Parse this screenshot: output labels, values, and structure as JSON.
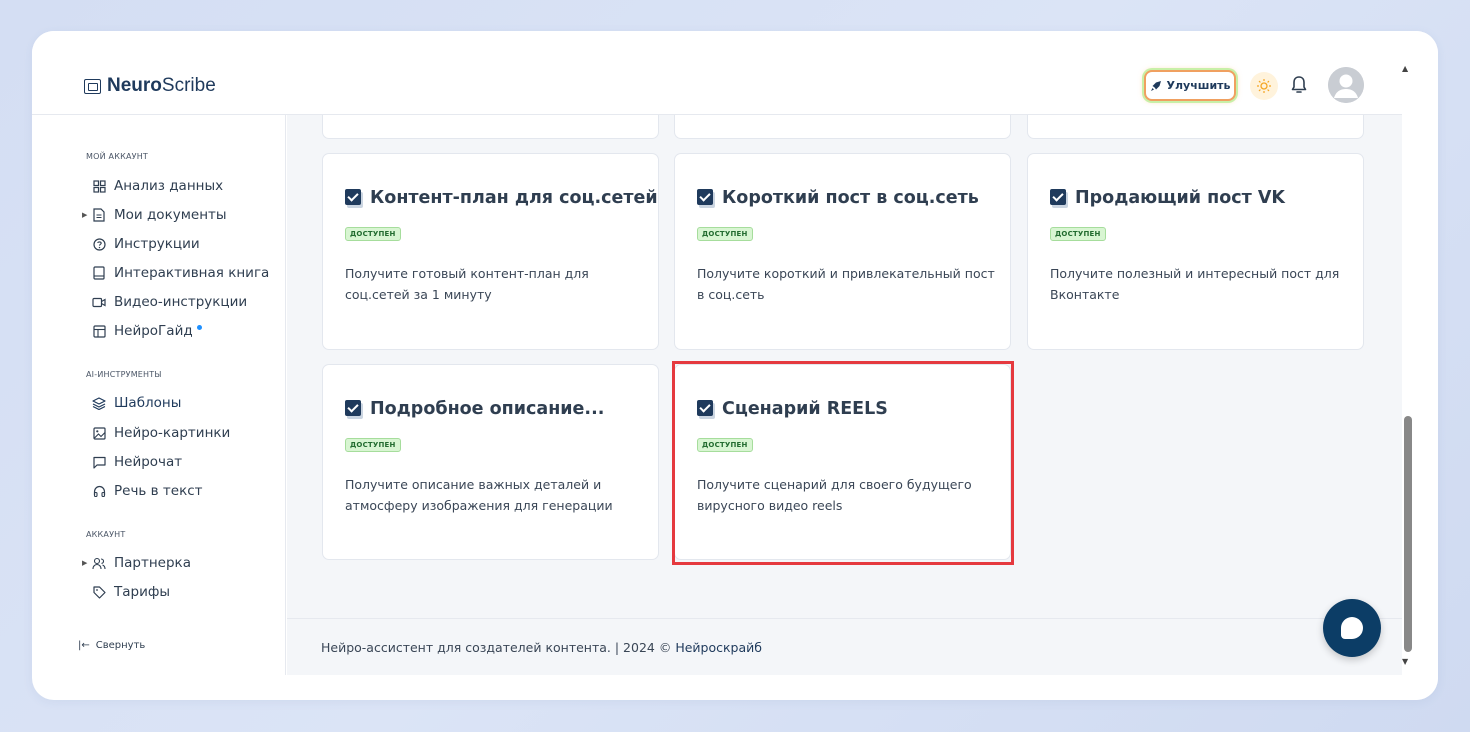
{
  "app": {
    "logo_bold": "Neuro",
    "logo_light": "Scribe"
  },
  "header": {
    "upgrade_label": "Улучшить"
  },
  "sidebar": {
    "sections": [
      {
        "title": "МОЙ АККАУНТ"
      },
      {
        "title": "AI-ИНСТРУМЕНТЫ"
      },
      {
        "title": "АККАУНТ"
      }
    ],
    "items": [
      {
        "label": "Анализ данных",
        "icon": "grid-icon"
      },
      {
        "label": "Мои документы",
        "icon": "document-icon"
      },
      {
        "label": "Инструкции",
        "icon": "help-circle-icon"
      },
      {
        "label": "Интерактивная книга",
        "icon": "book-icon"
      },
      {
        "label": "Видео-инструкции",
        "icon": "video-icon"
      },
      {
        "label": "НейроГайд",
        "icon": "layout-icon"
      },
      {
        "label": "Шаблоны",
        "icon": "layers-icon"
      },
      {
        "label": "Нейро-картинки",
        "icon": "image-icon"
      },
      {
        "label": "Нейрочат",
        "icon": "message-icon"
      },
      {
        "label": "Речь в текст",
        "icon": "headphones-icon"
      },
      {
        "label": "Партнерка",
        "icon": "users-icon"
      },
      {
        "label": "Тарифы",
        "icon": "tag-icon"
      }
    ],
    "collapse_label": "Свернуть"
  },
  "cards": [
    {
      "title": "Контент-план для соц.сетей",
      "badge": "ДОСТУПЕН",
      "desc": "Получите готовый контент-план для соц.сетей за 1 минуту"
    },
    {
      "title": "Короткий пост в соц.сеть",
      "badge": "ДОСТУПЕН",
      "desc": "Получите короткий и привлекательный пост в соц.сеть"
    },
    {
      "title": "Продающий пост VK",
      "badge": "ДОСТУПЕН",
      "desc": "Получите полезный и интересный пост для Вконтакте"
    },
    {
      "title": "Подробное описание...",
      "badge": "ДОСТУПЕН",
      "desc": "Получите описание важных деталей и атмосферу изображения для генерации"
    },
    {
      "title": "Сценарий REELS",
      "badge": "ДОСТУПЕН",
      "desc": "Получите сценарий для своего будущего вирусного видео reels"
    }
  ],
  "footer": {
    "text": "Нейро-ассистент для создателей контента.  | 2024 ©",
    "link": "Нейроскрайб"
  },
  "colors": {
    "brand": "#1f3a5c",
    "badge_bg": "#d8f5d2",
    "highlight": "#e5393f",
    "chat_fab": "#0c3d66"
  }
}
